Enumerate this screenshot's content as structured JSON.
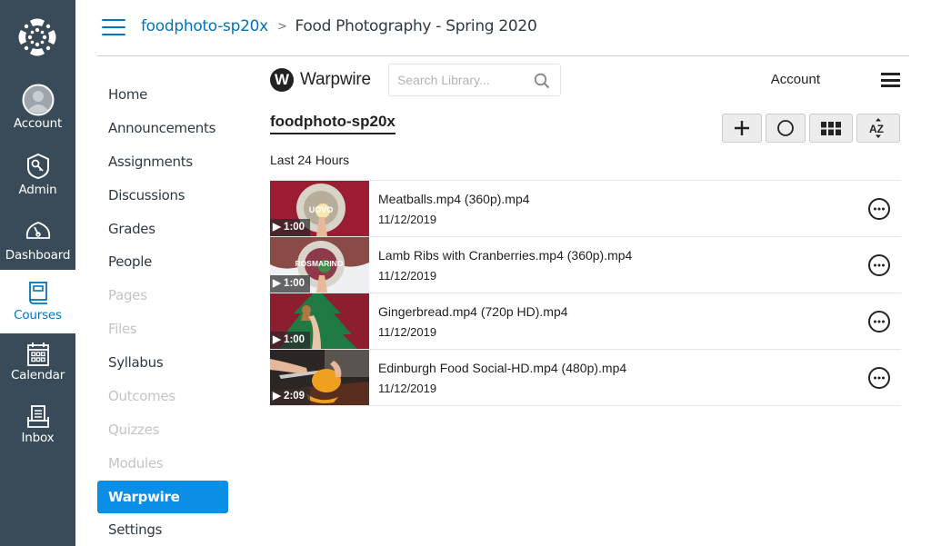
{
  "global_nav": {
    "logo": "canvas-logo-icon",
    "items": [
      {
        "label": "Account",
        "icon": "avatar-icon",
        "active": false
      },
      {
        "label": "Admin",
        "icon": "shield-key-icon",
        "active": false
      },
      {
        "label": "Dashboard",
        "icon": "speedometer-icon",
        "active": false
      },
      {
        "label": "Courses",
        "icon": "book-icon",
        "active": true
      },
      {
        "label": "Calendar",
        "icon": "calendar-icon",
        "active": false
      },
      {
        "label": "Inbox",
        "icon": "inbox-icon",
        "active": false
      }
    ],
    "active_color": "#0374b5",
    "background": "#394b58"
  },
  "header": {
    "breadcrumb": {
      "course_code": "foodphoto-sp20x",
      "separator": ">",
      "current": "Food Photography - Spring 2020"
    }
  },
  "course_nav": {
    "items": [
      {
        "label": "Home",
        "state": "enabled"
      },
      {
        "label": "Announcements",
        "state": "enabled"
      },
      {
        "label": "Assignments",
        "state": "enabled"
      },
      {
        "label": "Discussions",
        "state": "enabled"
      },
      {
        "label": "Grades",
        "state": "enabled"
      },
      {
        "label": "People",
        "state": "enabled"
      },
      {
        "label": "Pages",
        "state": "disabled"
      },
      {
        "label": "Files",
        "state": "disabled"
      },
      {
        "label": "Syllabus",
        "state": "enabled"
      },
      {
        "label": "Outcomes",
        "state": "disabled"
      },
      {
        "label": "Quizzes",
        "state": "disabled"
      },
      {
        "label": "Modules",
        "state": "disabled"
      },
      {
        "label": "Warpwire",
        "state": "active"
      },
      {
        "label": "Settings",
        "state": "enabled"
      }
    ],
    "active_color": "#0b8ee6"
  },
  "warpwire": {
    "brand": "Warpwire",
    "logo_letter": "W",
    "search": {
      "placeholder": "Search Library...",
      "value": ""
    },
    "account_label": "Account",
    "library_title": "foodphoto-sp20x",
    "toolbar": [
      {
        "name": "add",
        "icon": "plus-icon"
      },
      {
        "name": "record",
        "icon": "circle-icon"
      },
      {
        "name": "grid-view",
        "icon": "grid-icon"
      },
      {
        "name": "sort",
        "icon": "sort-az-icon"
      }
    ],
    "section_label": "Last 24 Hours",
    "media": [
      {
        "title": "Meatballs.mp4 (360p).mp4",
        "date": "11/12/2019",
        "duration": "1:00",
        "thumb_text": "UOVO"
      },
      {
        "title": "Lamb Ribs with Cranberries.mp4 (360p).mp4",
        "date": "11/12/2019",
        "duration": "1:00",
        "thumb_text": "ROSMARINO"
      },
      {
        "title": "Gingerbread.mp4 (720p HD).mp4",
        "date": "11/12/2019",
        "duration": "1:00",
        "thumb_text": ""
      },
      {
        "title": "Edinburgh Food Social-HD.mp4 (480p).mp4",
        "date": "11/12/2019",
        "duration": "2:09",
        "thumb_text": ""
      }
    ]
  }
}
